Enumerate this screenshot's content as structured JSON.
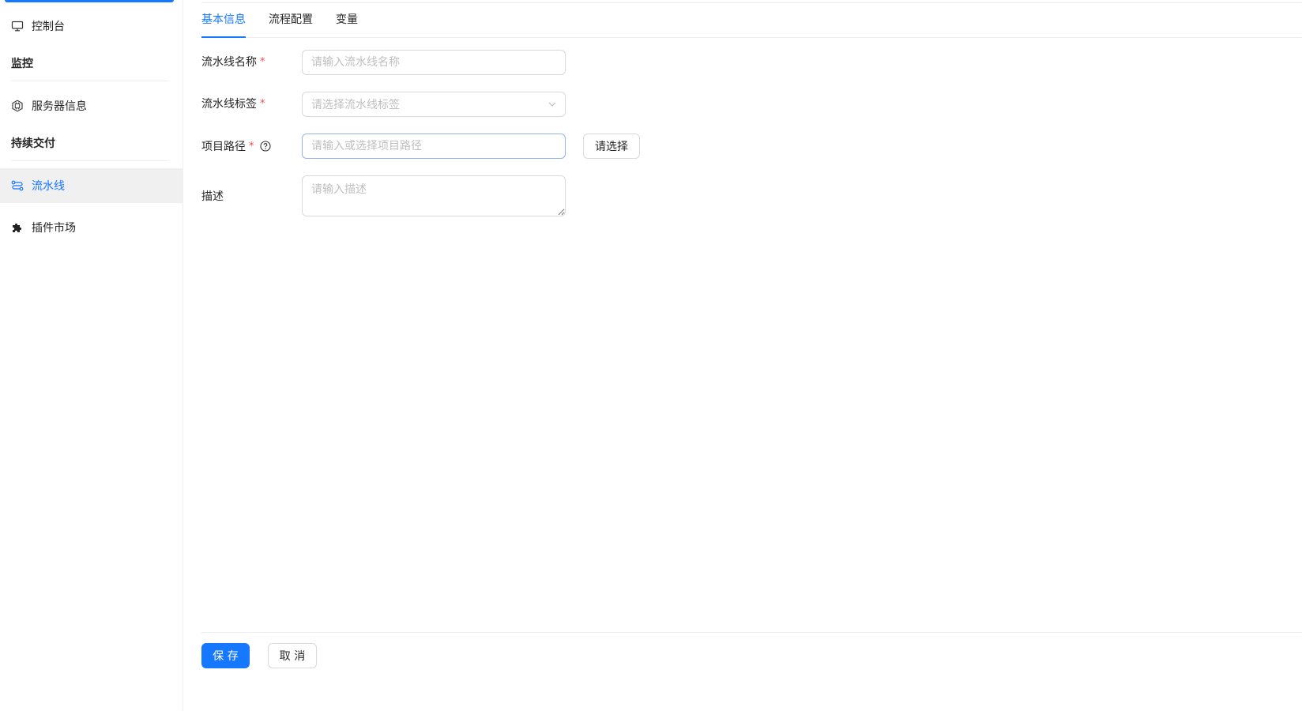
{
  "sidebar": {
    "items": {
      "console": {
        "label": "控制台",
        "icon": "monitor-icon"
      },
      "server": {
        "label": "服务器信息",
        "icon": "chip-icon"
      },
      "pipeline": {
        "label": "流水线",
        "icon": "pipeline-icon"
      },
      "plugins": {
        "label": "插件市场",
        "icon": "puzzle-icon"
      }
    },
    "groups": {
      "monitor": "监控",
      "delivery": "持续交付"
    },
    "active": "pipeline"
  },
  "tabs": [
    {
      "label": "基本信息",
      "active": true
    },
    {
      "label": "流程配置",
      "active": false
    },
    {
      "label": "变量",
      "active": false
    }
  ],
  "form": {
    "name": {
      "label": "流水线名称",
      "required_mark": "*",
      "value": "",
      "placeholder": "请输入流水线名称"
    },
    "tag": {
      "label": "流水线标签",
      "required_mark": "*",
      "placeholder": "请选择流水线标签"
    },
    "path": {
      "label": "项目路径",
      "required_mark": "*",
      "value": "",
      "placeholder": "请输入或选择项目路径",
      "select_button": "请选择"
    },
    "desc": {
      "label": "描述",
      "value": "",
      "placeholder": "请输入描述"
    }
  },
  "footer": {
    "save": "保 存",
    "cancel": "取 消"
  },
  "colors": {
    "primary": "#1677ff",
    "required": "#ff4d4f",
    "active_bg": "#f0f0f0"
  }
}
